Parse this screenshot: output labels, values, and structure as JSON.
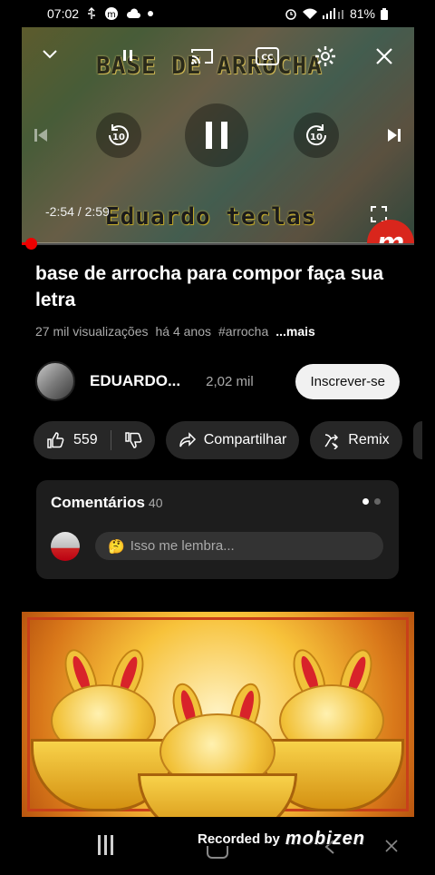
{
  "status_bar": {
    "time": "07:02",
    "battery": "81%"
  },
  "player": {
    "overlay_text_top": "BASE DE ARROCHA",
    "overlay_text_bottom": "Eduardo teclas",
    "time_display": "-2:54 / 2:59",
    "progress_fraction": 0.03,
    "mobizen_badge": "m"
  },
  "video": {
    "title": "base de arrocha para compor faça sua letra",
    "views": "27 mil visualizações",
    "age": "há 4 anos",
    "hashtag": "#arrocha",
    "more_label": "...mais"
  },
  "channel": {
    "name": "EDUARDO...",
    "subscribers": "2,02 mil",
    "subscribe_label": "Inscrever-se"
  },
  "actions": {
    "likes": "559",
    "share_label": "Compartilhar",
    "remix_label": "Remix"
  },
  "comments": {
    "heading": "Comentários",
    "count": "40",
    "placeholder_emoji": "🤔",
    "placeholder": "Isso me lembra..."
  },
  "watermark": {
    "recorded_by": "Recorded by",
    "brand": "mobizen"
  },
  "colors": {
    "accent_red": "#e00000",
    "chip_bg": "#272727",
    "subscribe_bg": "#f1f1f1"
  }
}
